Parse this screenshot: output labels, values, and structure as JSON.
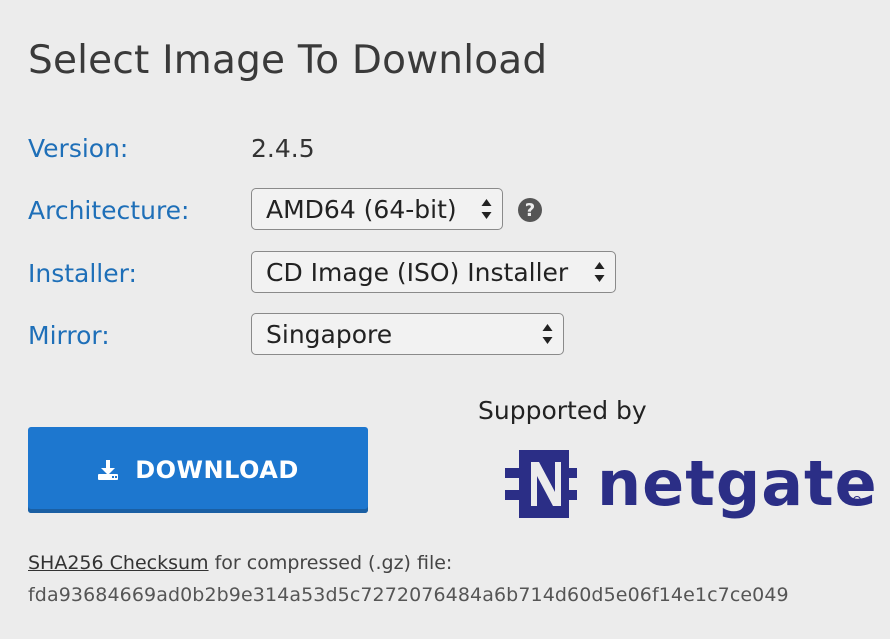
{
  "page": {
    "title": "Select Image To Download"
  },
  "fields": {
    "version": {
      "label": "Version:",
      "value": "2.4.5"
    },
    "architecture": {
      "label": "Architecture:",
      "selected": "AMD64 (64-bit)",
      "help_icon": "question-circle-icon"
    },
    "installer": {
      "label": "Installer:",
      "selected": "CD Image (ISO) Installer"
    },
    "mirror": {
      "label": "Mirror:",
      "selected": "Singapore"
    }
  },
  "download": {
    "label": "DOWNLOAD",
    "icon": "download-tray-icon",
    "color": "#1d77cf"
  },
  "sponsor": {
    "supported_by": "Supported by",
    "brand": "netgate",
    "brand_color": "#2b2e86"
  },
  "checksum": {
    "link_label": "SHA256 Checksum",
    "suffix": " for compressed (.gz) file:",
    "hash": "fda93684669ad0b2b9e314a53d5c7272076484a6b714d60d5e06f14e1c7ce049"
  },
  "colors": {
    "label": "#1e6fb8",
    "background": "#ececec"
  }
}
